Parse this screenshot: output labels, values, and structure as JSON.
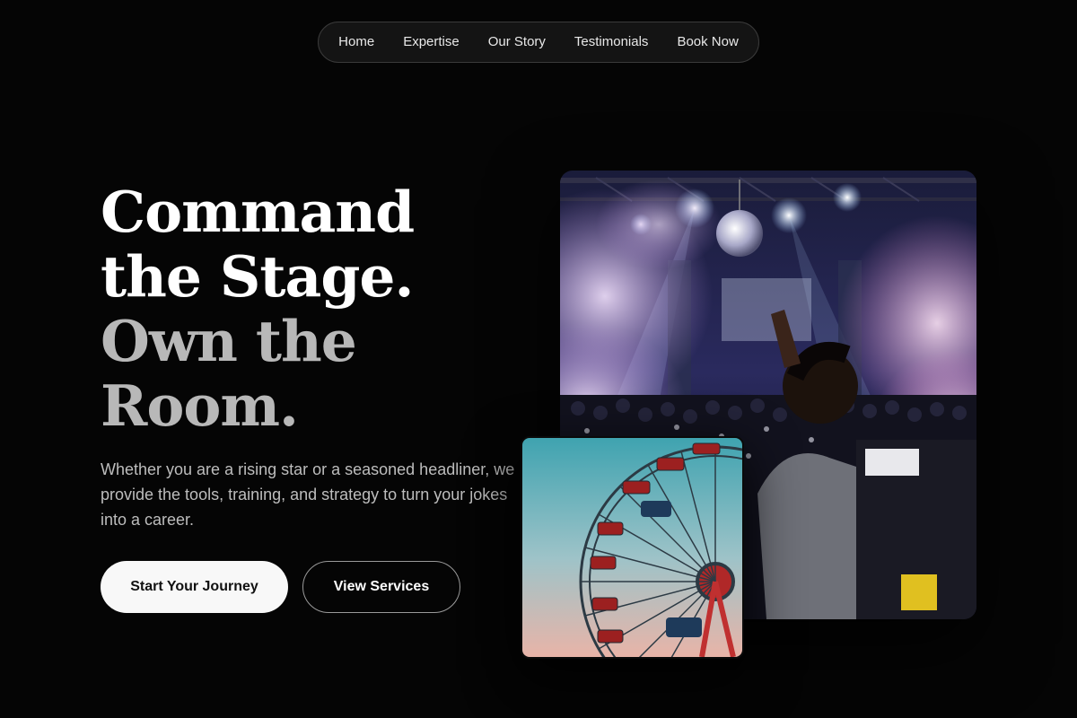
{
  "nav": {
    "items": [
      "Home",
      "Expertise",
      "Our Story",
      "Testimonials",
      "Book Now"
    ]
  },
  "hero": {
    "title_line1": "Command",
    "title_line2": "the Stage.",
    "title_line3": "Own the",
    "title_line4": "Room.",
    "subtitle": "Whether you are a rising star or a seasoned headliner, we provide the tools, training, and strategy to turn your jokes into a career.",
    "primary_button": "Start Your Journey",
    "secondary_button": "View Services"
  },
  "images": {
    "main": {
      "subject": "concert-crowd-dj-photo"
    },
    "small": {
      "subject": "ferris-wheel-photo"
    }
  },
  "colors": {
    "background": "#050505",
    "title_bright": "#ffffff",
    "title_muted": "#b8b8b8",
    "button_primary_bg": "#f8f8f8"
  }
}
